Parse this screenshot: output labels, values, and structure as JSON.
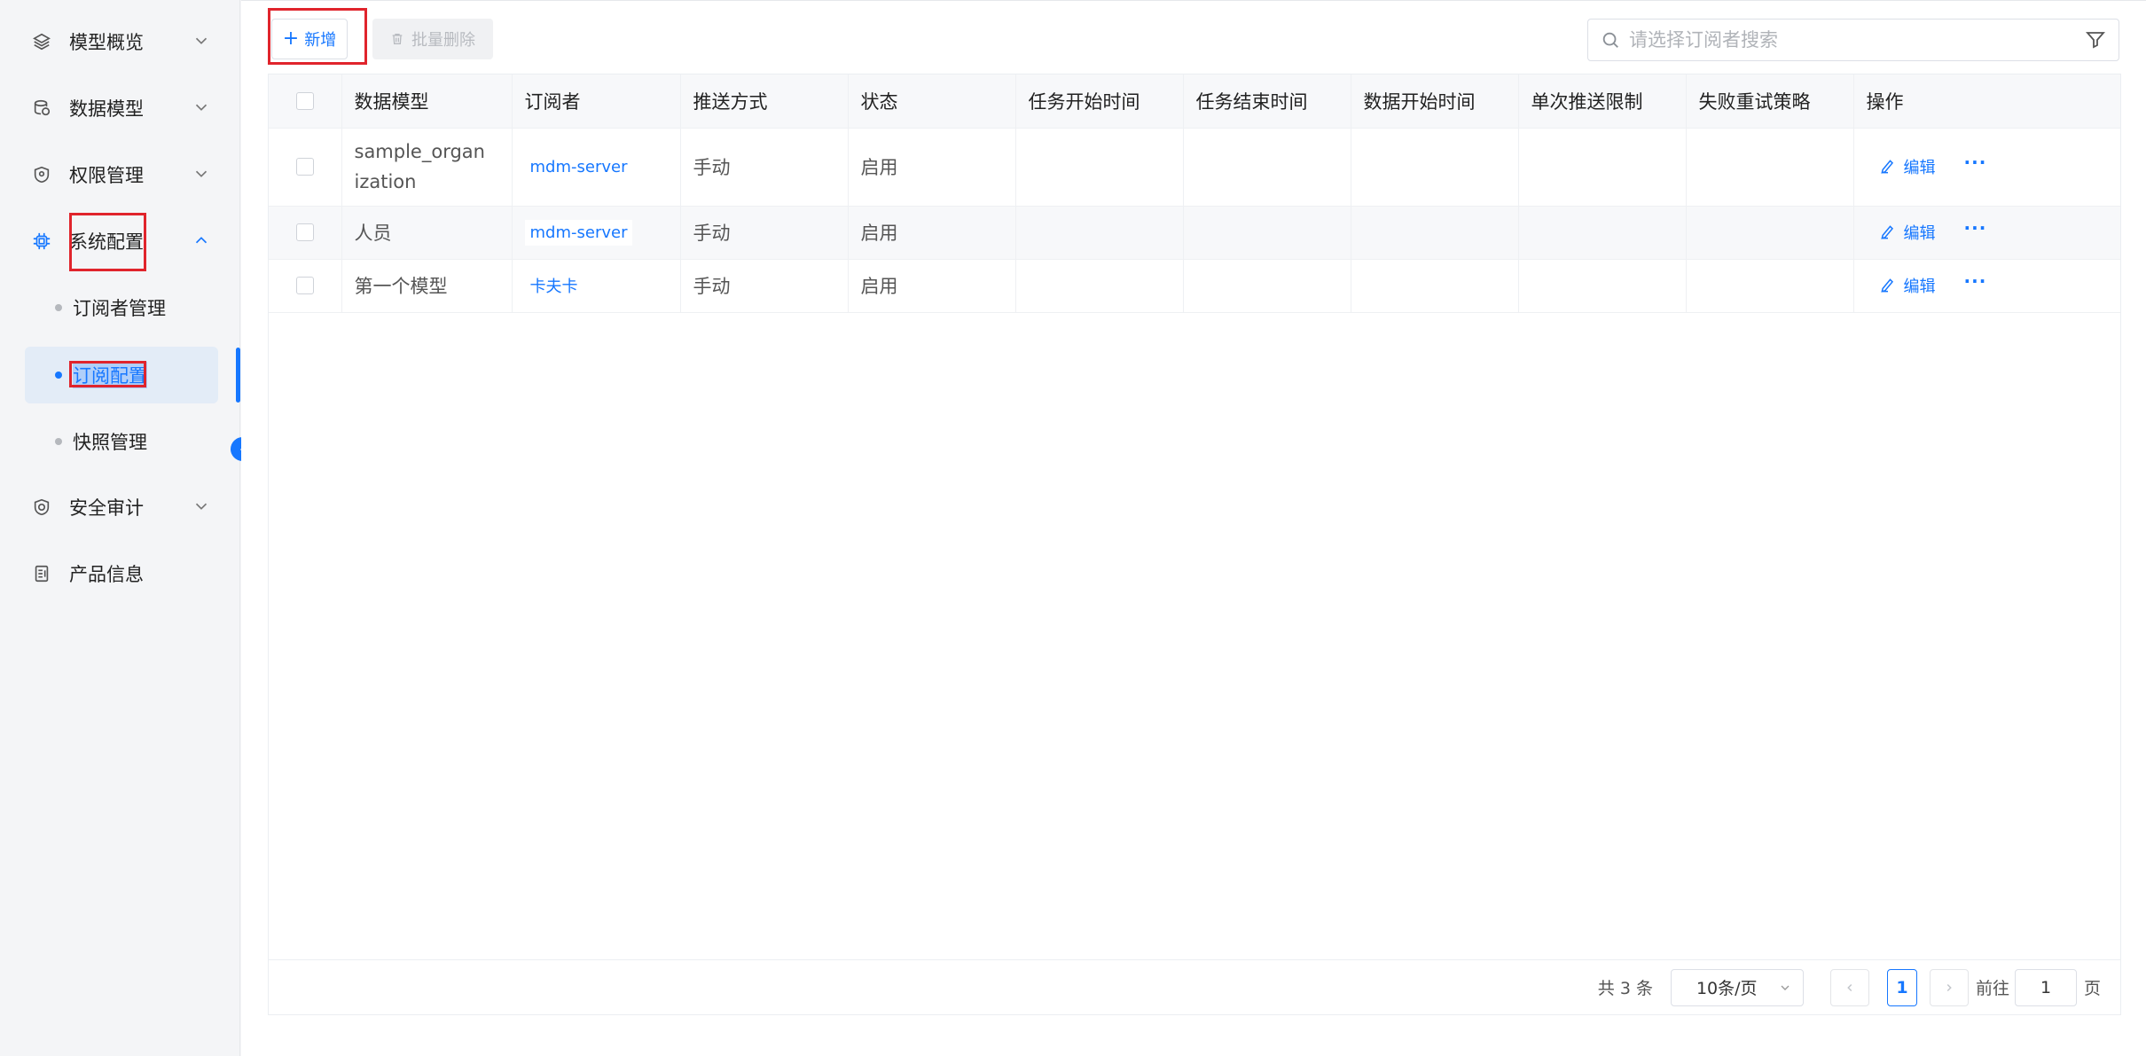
{
  "sidebar": {
    "items": [
      {
        "label": "模型概览",
        "icon": "layers-icon"
      },
      {
        "label": "数据模型",
        "icon": "database-icon"
      },
      {
        "label": "权限管理",
        "icon": "shield-icon"
      },
      {
        "label": "系统配置",
        "icon": "chip-icon"
      },
      {
        "label": "安全审计",
        "icon": "audit-shield-icon"
      },
      {
        "label": "产品信息",
        "icon": "document-icon"
      }
    ],
    "sub_items": [
      {
        "label": "订阅者管理"
      },
      {
        "label": "订阅配置"
      },
      {
        "label": "快照管理"
      }
    ]
  },
  "toolbar": {
    "add_label": "新增",
    "batch_delete_label": "批量删除"
  },
  "search": {
    "placeholder": "请选择订阅者搜索"
  },
  "table": {
    "columns": [
      "数据模型",
      "订阅者",
      "推送方式",
      "状态",
      "任务开始时间",
      "任务结束时间",
      "数据开始时间",
      "单次推送限制",
      "失败重试策略",
      "操作"
    ],
    "rows": [
      {
        "model": "sample_organization",
        "subscriber": "mdm-server",
        "push": "手动",
        "status": "启用",
        "task_start": "",
        "task_end": "",
        "data_start": "",
        "limit": "",
        "retry": ""
      },
      {
        "model": "人员",
        "subscriber": "mdm-server",
        "push": "手动",
        "status": "启用",
        "task_start": "",
        "task_end": "",
        "data_start": "",
        "limit": "",
        "retry": ""
      },
      {
        "model": "第一个模型",
        "subscriber": "卡夫卡",
        "push": "手动",
        "status": "启用",
        "task_start": "",
        "task_end": "",
        "data_start": "",
        "limit": "",
        "retry": ""
      }
    ],
    "edit_label": "编辑",
    "more_label": "···"
  },
  "pagination": {
    "total_text": "共 3 条",
    "page_size": "10条/页",
    "current_page": "1",
    "goto_label": "前往",
    "goto_value": "1",
    "goto_suffix": "页"
  },
  "colors": {
    "accent": "#1677ff",
    "highlight": "#e0242c"
  }
}
